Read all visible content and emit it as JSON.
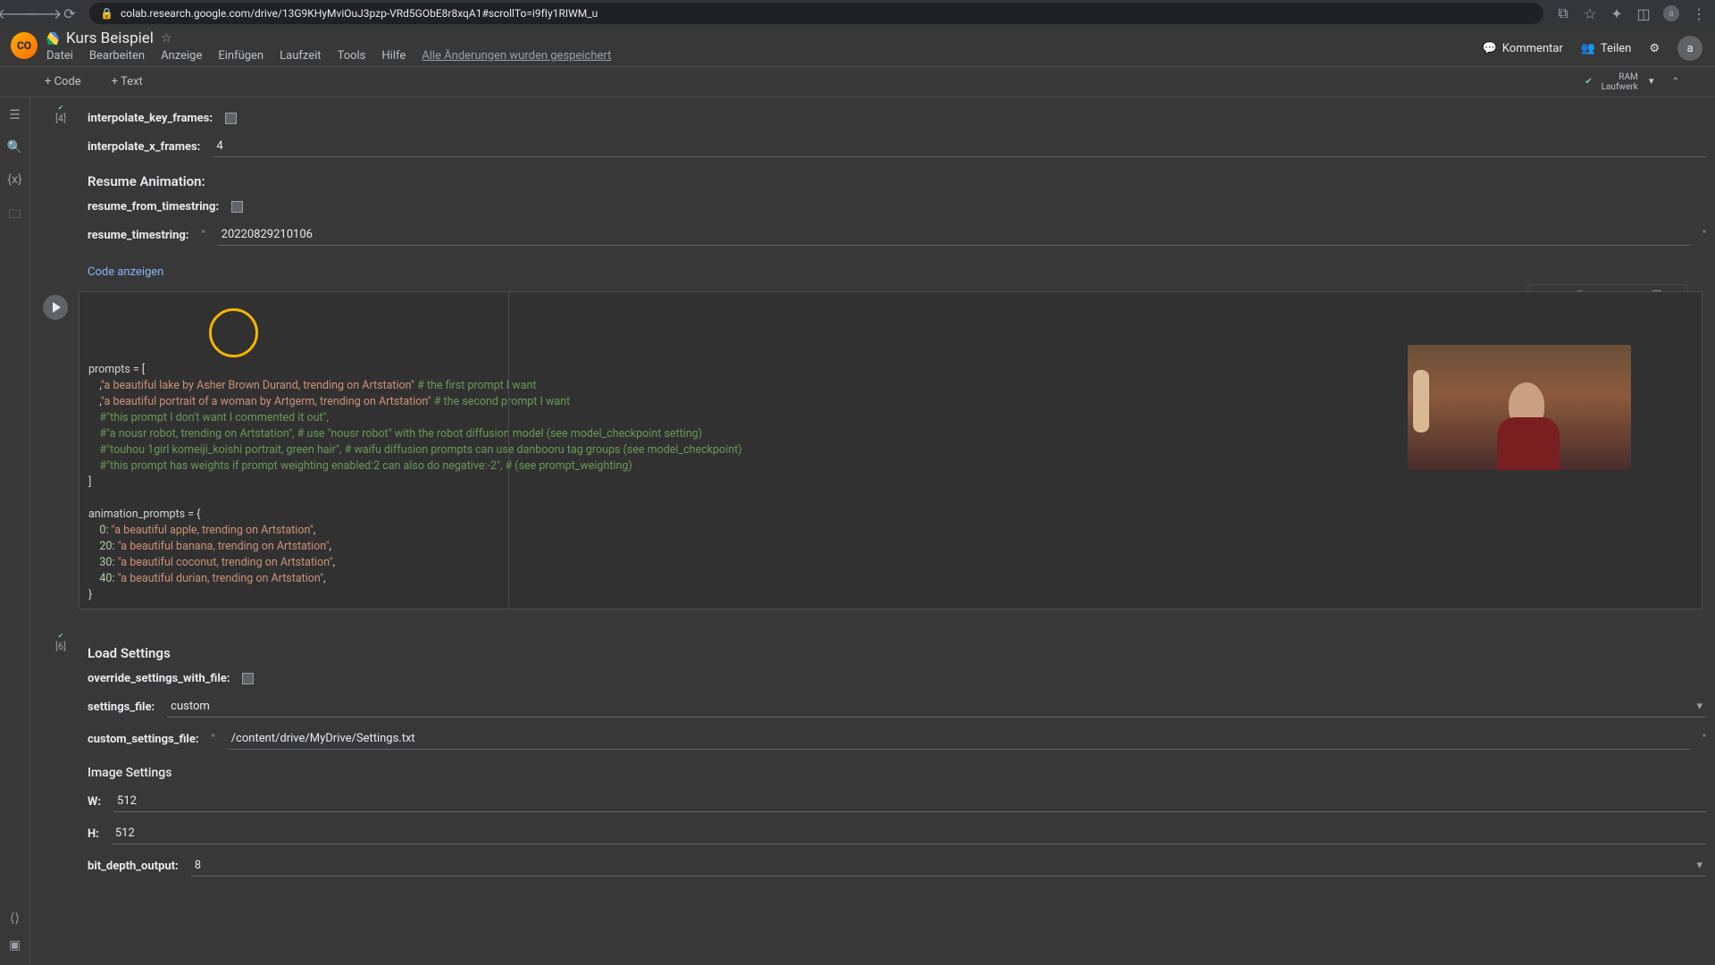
{
  "browser": {
    "url": "colab.research.google.com/drive/13G9KHyMviOuJ3pzp-VRd5GObE8r8xqA1#scrollTo=i9fIy1RIWM_u"
  },
  "header": {
    "title": "Kurs Beispiel",
    "menus": [
      "Datei",
      "Bearbeiten",
      "Anzeige",
      "Einfügen",
      "Laufzeit",
      "Tools",
      "Hilfe"
    ],
    "saved_msg": "Alle Änderungen wurden gespeichert",
    "comment": "Kommentar",
    "share": "Teilen",
    "avatar_letter": "a"
  },
  "toolbar": {
    "add_code": "+ Code",
    "add_text": "+ Text",
    "ram": "RAM",
    "disk": "Laufwerk"
  },
  "cell4": {
    "exec": "[4]",
    "interpolate_key_frames": "interpolate_key_frames:",
    "interpolate_x_frames": "interpolate_x_frames:",
    "interpolate_x_frames_val": "4",
    "resume_heading": "Resume Animation:",
    "resume_from": "resume_from_timestring:",
    "resume_timestring": "resume_timestring:",
    "resume_timestring_val": "20220829210106",
    "show_code": "Code anzeigen"
  },
  "code_cell": {
    "lines": [
      {
        "t": "prompts = ["
      },
      {
        "pad": 4,
        "str": "\"a beautiful lake by Asher Brown Durand, trending on Artstation\"",
        "pun": ",",
        "com": " # the first prompt I want"
      },
      {
        "pad": 4,
        "str": "\"a beautiful portrait of a woman by Artgerm, trending on Artstation\"",
        "pun": ",",
        "com": " # the second prompt I want"
      },
      {
        "pad": 4,
        "com": "#\"this prompt I don't want I commented it out\","
      },
      {
        "pad": 4,
        "com": "#\"a nousr robot, trending on Artstation\", # use \"nousr robot\" with the robot diffusion model (see model_checkpoint setting)"
      },
      {
        "pad": 4,
        "com": "#\"touhou 1girl komeiji_koishi portrait, green hair\", # waifu diffusion prompts can use danbooru tag groups (see model_checkpoint)"
      },
      {
        "pad": 4,
        "com": "#\"this prompt has weights if prompt weighting enabled:2 can also do negative:-2\", # (see prompt_weighting)"
      },
      {
        "t": "]"
      },
      {
        "t": ""
      },
      {
        "t": "animation_prompts = {"
      },
      {
        "pad": 4,
        "num": "0",
        "pun": ": ",
        "str": "\"a beautiful apple, trending on Artstation\"",
        "pun2": ","
      },
      {
        "pad": 4,
        "num": "20",
        "pun": ": ",
        "str": "\"a beautiful banana, trending on Artstation\"",
        "pun2": ","
      },
      {
        "pad": 4,
        "num": "30",
        "pun": ": ",
        "str": "\"a beautiful coconut, trending on Artstation\"",
        "pun2": ","
      },
      {
        "pad": 4,
        "num": "40",
        "pun": ": ",
        "str": "\"a beautiful durian, trending on Artstation\"",
        "pun2": ","
      },
      {
        "t": "}"
      }
    ]
  },
  "cell6": {
    "exec": "[6]",
    "heading": "Load Settings",
    "override": "override_settings_with_file:",
    "settings_file": "settings_file:",
    "settings_file_val": "custom",
    "custom_settings_file": "custom_settings_file:",
    "custom_settings_file_val": "/content/drive/MyDrive/Settings.txt",
    "image_heading": "Image Settings",
    "w": "W:",
    "w_val": "512",
    "h": "H:",
    "h_val": "512",
    "bit_depth": "bit_depth_output:",
    "bit_depth_val": "8"
  }
}
